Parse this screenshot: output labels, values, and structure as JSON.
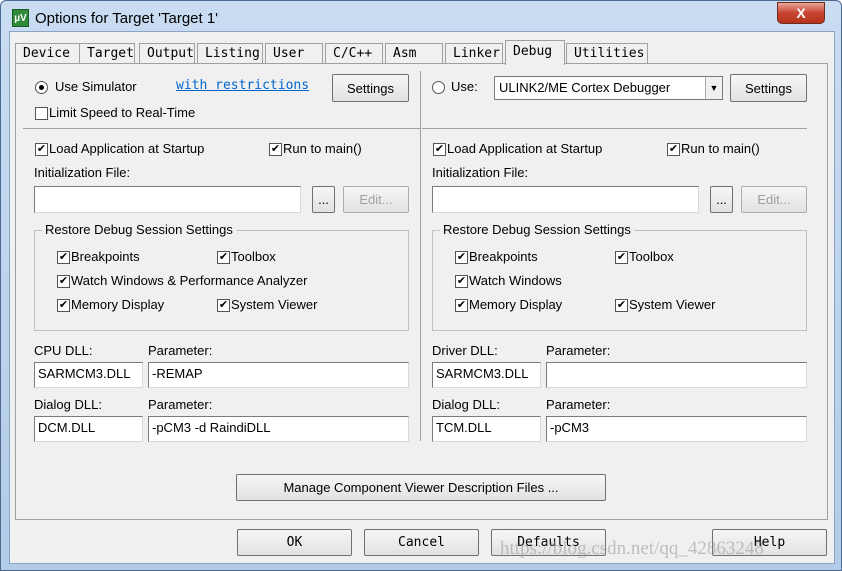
{
  "window": {
    "title": "Options for Target 'Target 1'",
    "close_label": "X"
  },
  "tabs": [
    {
      "label": "Device"
    },
    {
      "label": "Target"
    },
    {
      "label": "Output"
    },
    {
      "label": "Listing"
    },
    {
      "label": "User"
    },
    {
      "label": "C/C++"
    },
    {
      "label": "Asm"
    },
    {
      "label": "Linker"
    },
    {
      "label": "Debug",
      "active": true
    },
    {
      "label": "Utilities"
    }
  ],
  "left": {
    "mode_label": "Use Simulator",
    "mode_selected": true,
    "link": "with restrictions",
    "settings": "Settings",
    "limit_speed": {
      "label": "Limit Speed to Real-Time",
      "checked": false
    },
    "load_app": {
      "label": "Load Application at Startup",
      "checked": true
    },
    "run_main": {
      "label": "Run to main()",
      "checked": true
    },
    "init_label": "Initialization File:",
    "init_value": "",
    "browse": "...",
    "edit": "Edit...",
    "group_label": "Restore Debug Session Settings",
    "breakpoints": {
      "label": "Breakpoints",
      "checked": true
    },
    "toolbox": {
      "label": "Toolbox",
      "checked": true
    },
    "watch": {
      "label": "Watch Windows & Performance Analyzer",
      "checked": true
    },
    "memory": {
      "label": "Memory Display",
      "checked": true
    },
    "sysviewer": {
      "label": "System Viewer",
      "checked": true
    },
    "dll_label": "CPU DLL:",
    "dll_value": "SARMCM3.DLL",
    "param_label": "Parameter:",
    "param_value": "-REMAP",
    "dlg_label": "Dialog DLL:",
    "dlg_value": "DCM.DLL",
    "dlg_param_label": "Parameter:",
    "dlg_param_value": "-pCM3 -d RaindiDLL"
  },
  "right": {
    "mode_label": "Use:",
    "mode_selected": false,
    "debugger": "ULINK2/ME Cortex Debugger",
    "settings": "Settings",
    "load_app": {
      "label": "Load Application at Startup",
      "checked": true
    },
    "run_main": {
      "label": "Run to main()",
      "checked": true
    },
    "init_label": "Initialization File:",
    "init_value": "",
    "browse": "...",
    "edit": "Edit...",
    "group_label": "Restore Debug Session Settings",
    "breakpoints": {
      "label": "Breakpoints",
      "checked": true
    },
    "toolbox": {
      "label": "Toolbox",
      "checked": true
    },
    "watch": {
      "label": "Watch Windows",
      "checked": true
    },
    "memory": {
      "label": "Memory Display",
      "checked": true
    },
    "sysviewer": {
      "label": "System Viewer",
      "checked": true
    },
    "dll_label": "Driver DLL:",
    "dll_value": "SARMCM3.DLL",
    "param_label": "Parameter:",
    "param_value": "",
    "dlg_label": "Dialog DLL:",
    "dlg_value": "TCM.DLL",
    "dlg_param_label": "Parameter:",
    "dlg_param_value": "-pCM3"
  },
  "manage_button": "Manage Component Viewer Description Files ...",
  "buttons": {
    "ok": "OK",
    "cancel": "Cancel",
    "defaults": "Defaults",
    "help": "Help"
  },
  "watermark": "https://blog.csdn.net/qq_42863248"
}
